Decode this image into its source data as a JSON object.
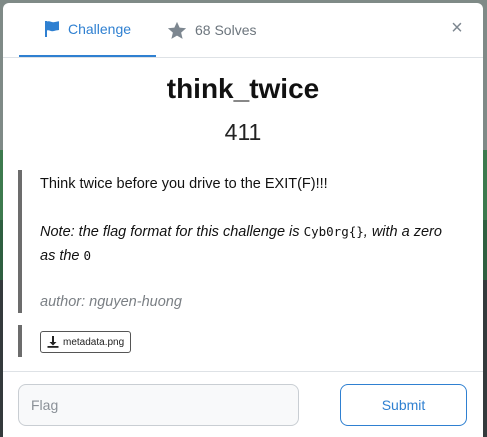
{
  "tabs": {
    "challenge_label": "Challenge",
    "solves_label": "68 Solves",
    "close_glyph": "×"
  },
  "challenge": {
    "name": "think_twice",
    "points": "411",
    "description": {
      "line1": "Think twice before you drive to the EXIT(F)!!!",
      "note_prefix": "Note: the flag format for this challenge is ",
      "note_code": "Cyb0rg{}",
      "note_mid": ", with a zero as the ",
      "note_code2": "0",
      "author": "author: nguyen-huong"
    },
    "files": [
      {
        "name": "metadata.png",
        "icon": "download-icon"
      }
    ]
  },
  "form": {
    "flag_placeholder": "Flag",
    "flag_value": "",
    "submit_label": "Submit"
  },
  "colors": {
    "accent": "#2f80d1",
    "muted": "#6c757d"
  }
}
